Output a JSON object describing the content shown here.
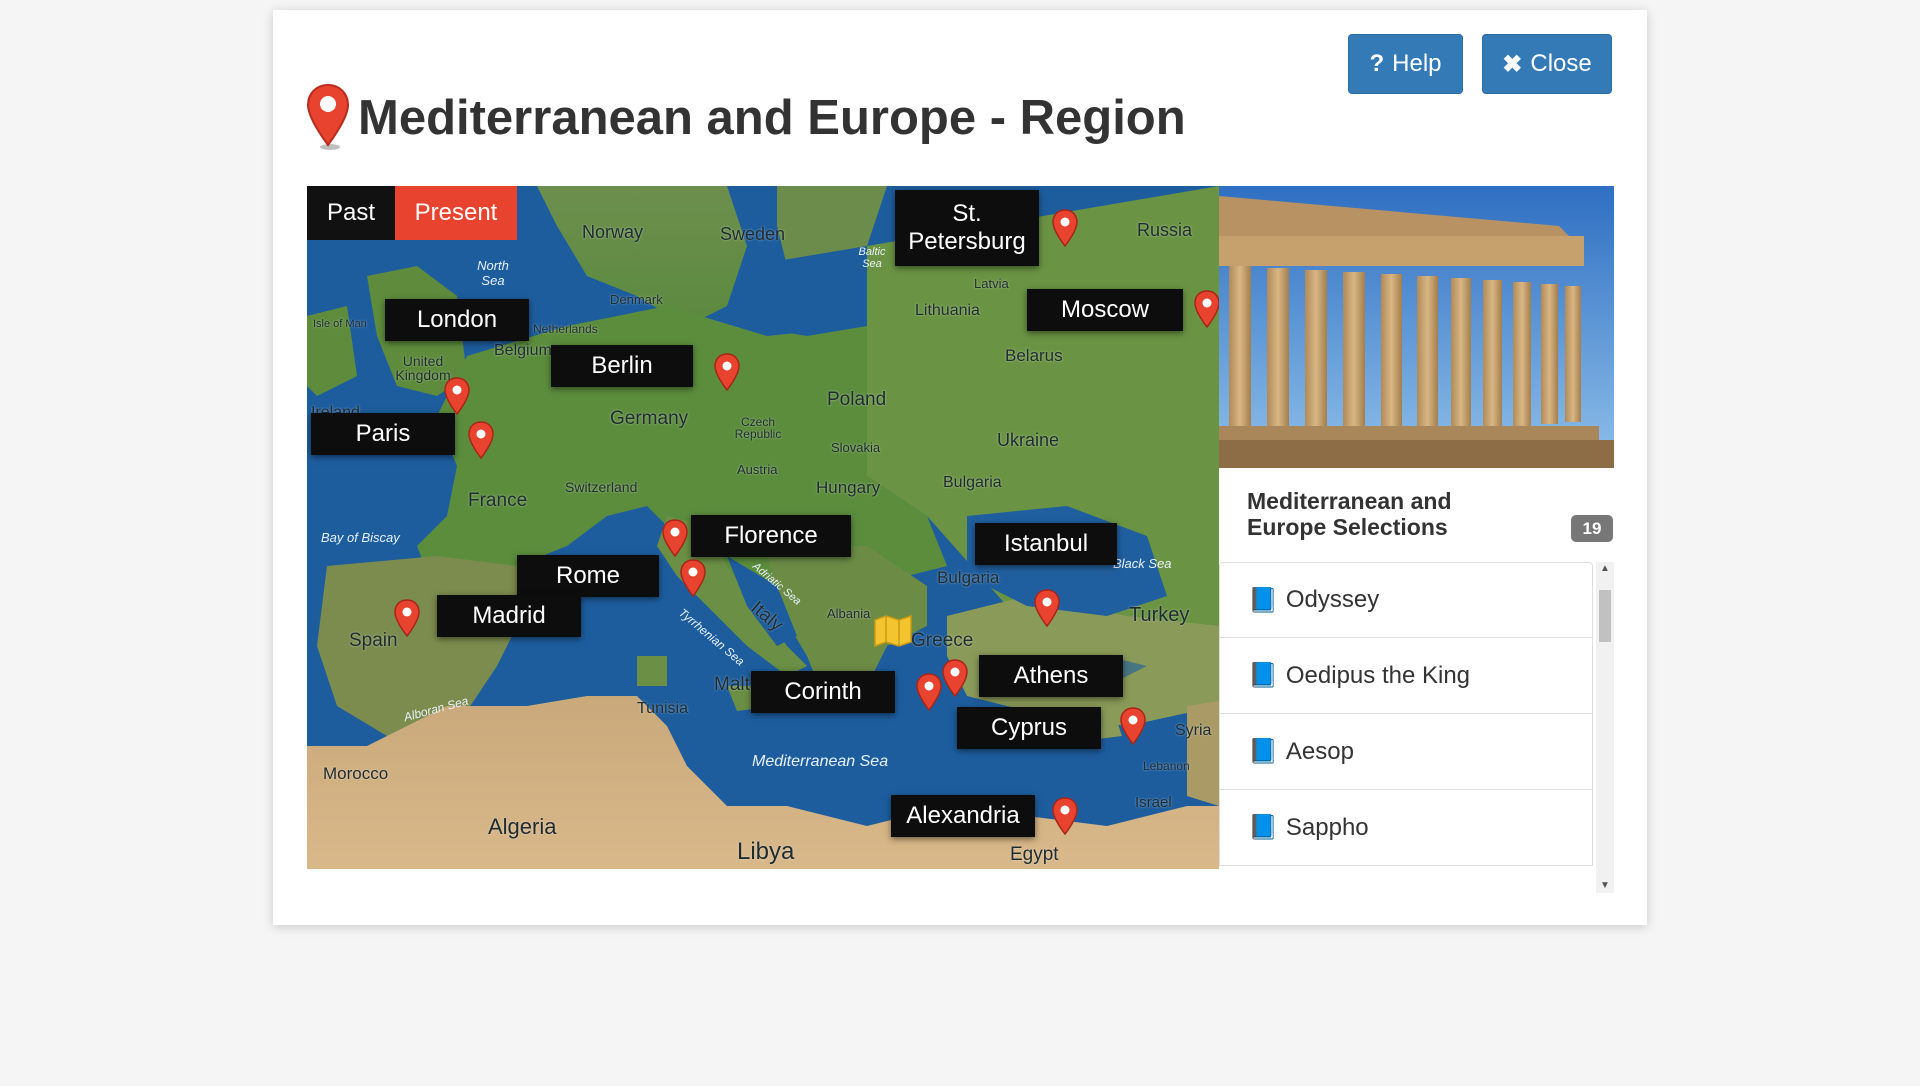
{
  "header": {
    "title": "Mediterranean and Europe - Region",
    "help_label": "Help",
    "close_label": "Close"
  },
  "toggle": {
    "past": "Past",
    "present": "Present"
  },
  "map_pins": [
    "St. Petersburg",
    "Moscow",
    "London",
    "Berlin",
    "Paris",
    "Florence",
    "Istanbul",
    "Rome",
    "Madrid",
    "Athens",
    "Corinth",
    "Cyprus",
    "Alexandria"
  ],
  "map_labels": {
    "norway": "Norway",
    "sweden": "Sweden",
    "russia": "Russia",
    "north_sea": "North Sea",
    "baltic_sea": "Baltic Sea",
    "latvia": "Latvia",
    "denmark": "Denmark",
    "lithuania": "Lithuania",
    "isle_of_man": "Isle of Man",
    "netherlands": "Netherlands",
    "belarus": "Belarus",
    "united_kingdom": "United Kingdom",
    "belgium": "Belgium",
    "ireland": "Ireland",
    "germany": "Germany",
    "poland": "Poland",
    "czech": "Czech Republic",
    "ukraine": "Ukraine",
    "slovakia": "Slovakia",
    "austria": "Austria",
    "france": "France",
    "switzerland": "Switzerland",
    "hungary": "Hungary",
    "bulgaria_n": "Bulgaria",
    "bay_of_biscay": "Bay of Biscay",
    "black_sea": "Black Sea",
    "adriatic_sea": "Adriatic Sea",
    "bulgaria_s": "Bulgaria",
    "turkey": "Turkey",
    "italy": "Italy",
    "albania": "Albania",
    "greece": "Greece",
    "spain": "Spain",
    "tyrrhenian_sea": "Tyrrhenian Sea",
    "malta": "Malta",
    "alboran_sea": "Alboran Sea",
    "tunisia": "Tunisia",
    "syria": "Syria",
    "mediterranean_sea": "Mediterranean Sea",
    "lebanon": "Lebanon",
    "morocco": "Morocco",
    "israel": "Israel",
    "algeria": "Algeria",
    "libya": "Libya",
    "egypt": "Egypt"
  },
  "selections": {
    "heading": "Mediterranean and Europe Selections",
    "count": "19",
    "items": [
      "Odyssey",
      "Oedipus the King",
      "Aesop",
      "Sappho"
    ]
  },
  "colors": {
    "primary": "#337ab7",
    "pin": "#e8432e",
    "present_active": "#e8432e"
  },
  "icons": {
    "title": "map-marker-icon",
    "help": "question-icon",
    "close": "times-icon",
    "list": "book-icon"
  }
}
